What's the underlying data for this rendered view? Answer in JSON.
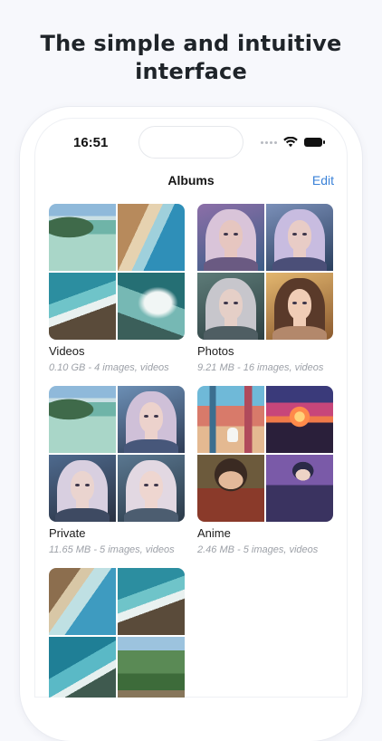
{
  "headline": {
    "line1": "The simple and intuitive",
    "line2": "interface"
  },
  "status_bar": {
    "time": "16:51"
  },
  "nav": {
    "title": "Albums",
    "edit_label": "Edit"
  },
  "albums": [
    {
      "name": "Videos",
      "meta": "0.10 GB - 4 images, videos",
      "thumbs": [
        "aerial beach photo",
        "beach coastline photo",
        "ocean waves photo",
        "surf from above photo"
      ]
    },
    {
      "name": "Photos",
      "meta": "9.21 MB - 16 images, videos",
      "thumbs": [
        "woman portrait",
        "woman portrait",
        "woman portrait",
        "woman portrait"
      ]
    },
    {
      "name": "Private",
      "meta": "11.65 MB - 5 images, videos",
      "thumbs": [
        "aerial beach photo",
        "woman portrait",
        "woman portrait",
        "woman portrait"
      ]
    },
    {
      "name": "Anime",
      "meta": "2.46 MB - 5 images, videos",
      "thumbs": [
        "anime street with cat",
        "anime sunset city",
        "anime warrior",
        "anime boy"
      ]
    },
    {
      "name": "",
      "meta": "",
      "thumbs": [
        "beach coastline photo",
        "ocean waves photo",
        "sea surf photo",
        "green cliffs photo"
      ]
    }
  ],
  "icons": [
    "signal-icon",
    "wifi-icon",
    "battery-icon"
  ],
  "colors": {
    "accent": "#3a82d8",
    "headline": "#1f2429",
    "meta": "#9da1a8"
  }
}
